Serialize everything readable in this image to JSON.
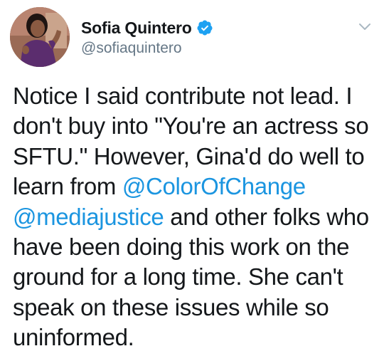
{
  "tweet": {
    "author": {
      "display_name": "Sofia Quintero",
      "handle": "@sofiaquintero",
      "verified": true,
      "verified_icon": "verified-badge-icon"
    },
    "menu_icon": "chevron-down-icon",
    "text_segments": [
      {
        "type": "text",
        "text": "Notice I said contribute not lead. I don't buy into \"You're an actress so SFTU.\" However, Gina'd do well to learn from "
      },
      {
        "type": "mention",
        "text": "@ColorOfChange"
      },
      {
        "type": "text",
        "text": " "
      },
      {
        "type": "mention",
        "text": "@mediajustice"
      },
      {
        "type": "text",
        "text": " and other folks who have been doing this work on the ground for a long time. She can't speak on these issues while so uninformed."
      }
    ]
  },
  "colors": {
    "text": "#14171a",
    "secondary": "#657786",
    "link": "#1b95e0",
    "verified": "#1da1f2"
  }
}
